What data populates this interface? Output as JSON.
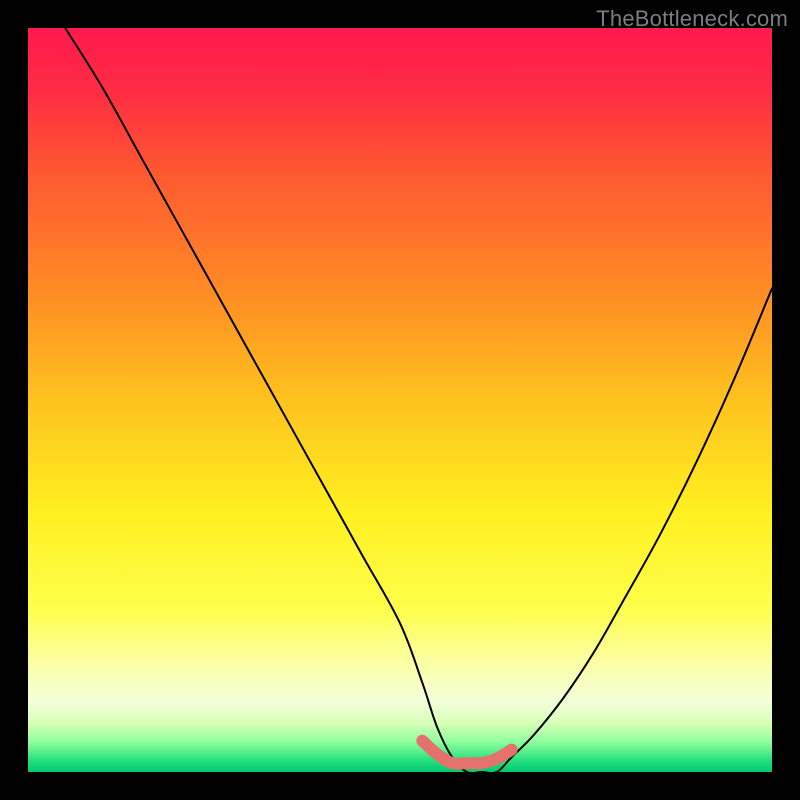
{
  "watermark": {
    "text": "TheBottleneck.com"
  },
  "colors": {
    "gradient_stops": [
      {
        "pos": 0.0,
        "color": "#ff1a4d"
      },
      {
        "pos": 0.08,
        "color": "#ff2a45"
      },
      {
        "pos": 0.2,
        "color": "#ff5a30"
      },
      {
        "pos": 0.35,
        "color": "#ff8a25"
      },
      {
        "pos": 0.5,
        "color": "#ffc21e"
      },
      {
        "pos": 0.65,
        "color": "#fff020"
      },
      {
        "pos": 0.78,
        "color": "#feff4a"
      },
      {
        "pos": 0.85,
        "color": "#fbffa0"
      },
      {
        "pos": 0.905,
        "color": "#f4ffda"
      },
      {
        "pos": 0.935,
        "color": "#d6ffb6"
      },
      {
        "pos": 0.96,
        "color": "#8cff9b"
      },
      {
        "pos": 0.985,
        "color": "#24e07e"
      },
      {
        "pos": 1.0,
        "color": "#00c870"
      }
    ],
    "curve_stroke": "#000000",
    "valley_highlight": "#e4716b"
  },
  "chart_data": {
    "type": "line",
    "title": "",
    "xlabel": "",
    "ylabel": "",
    "xlim": [
      0,
      100
    ],
    "ylim": [
      0,
      100
    ],
    "grid": false,
    "legend": false,
    "annotations": [
      "TheBottleneck.com"
    ],
    "series": [
      {
        "name": "bottleneck-curve",
        "x": [
          5,
          10,
          15,
          20,
          25,
          30,
          35,
          40,
          45,
          50,
          53,
          55,
          57,
          59,
          61,
          63,
          65,
          68,
          72,
          76,
          80,
          85,
          90,
          95,
          100
        ],
        "values": [
          100,
          92,
          83,
          74,
          65,
          56,
          47,
          38,
          29,
          20,
          12,
          6,
          2,
          0,
          0,
          0,
          2,
          5,
          10,
          16,
          23,
          32,
          42,
          53,
          65
        ]
      },
      {
        "name": "valley-highlight",
        "x": [
          53,
          55,
          57,
          59,
          61,
          63,
          65
        ],
        "values": [
          5,
          2,
          0,
          0,
          0,
          1,
          3
        ]
      }
    ]
  }
}
